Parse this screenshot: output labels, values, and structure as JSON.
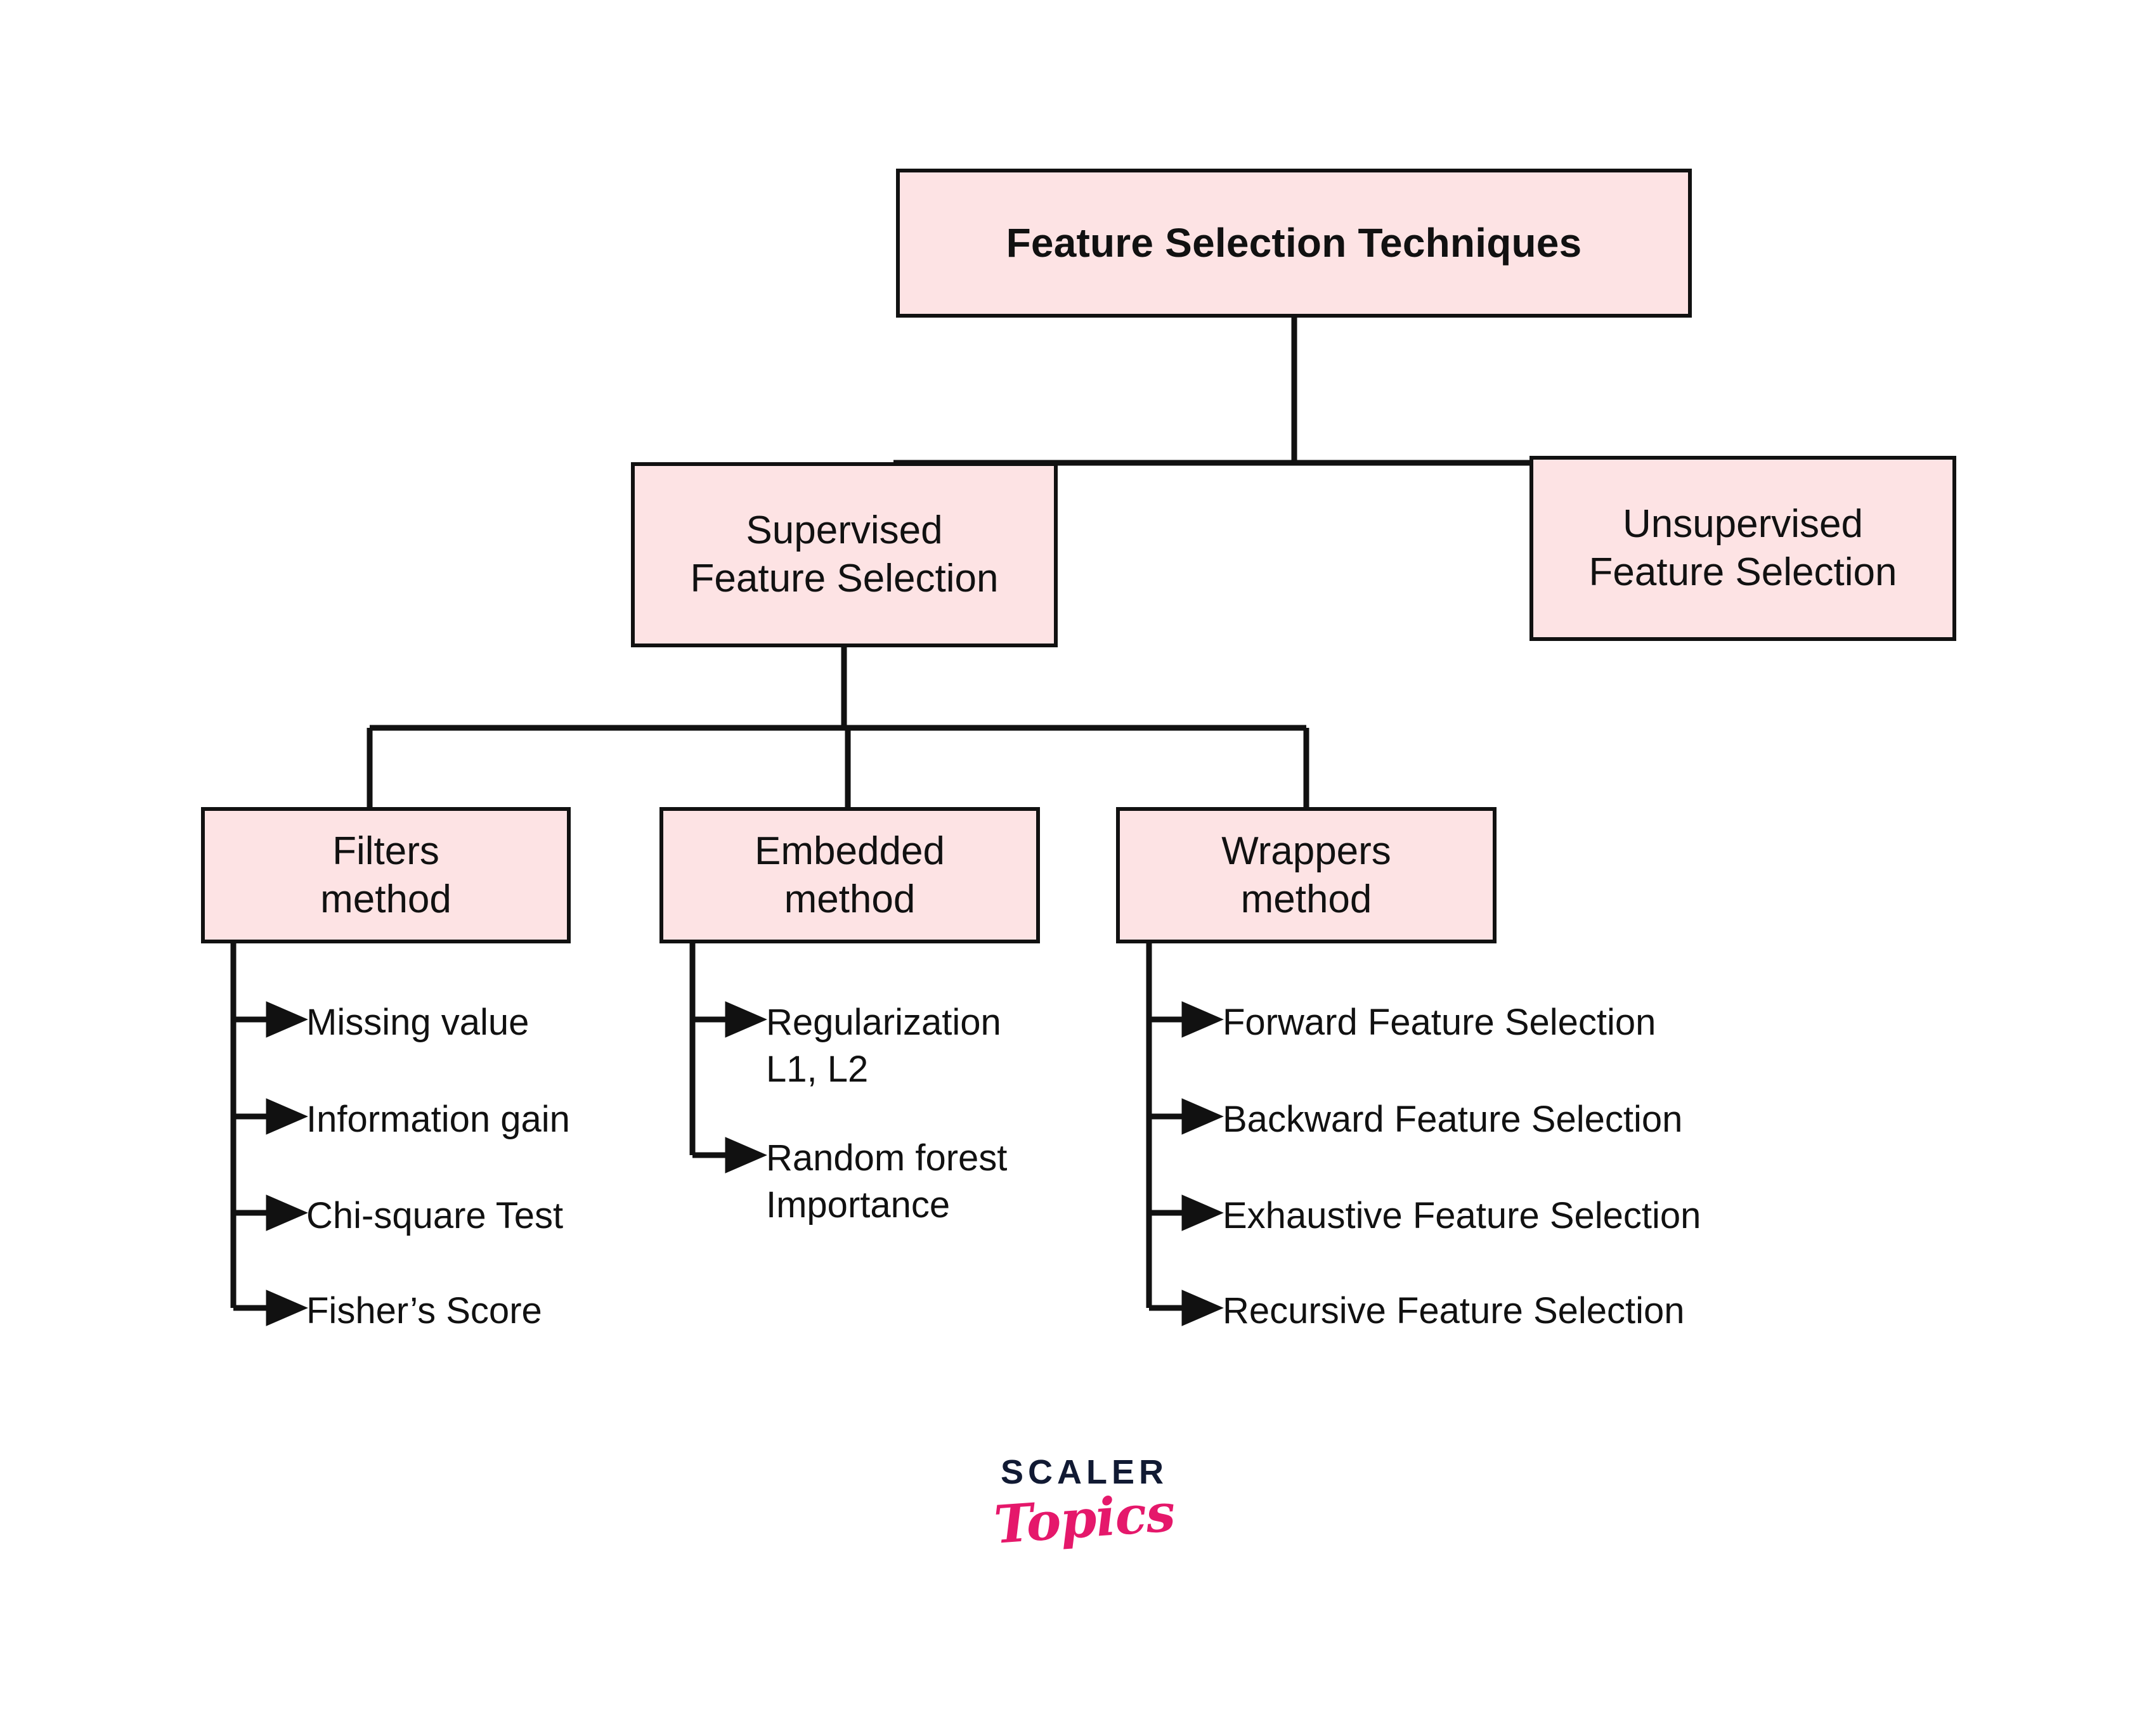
{
  "diagram": {
    "title": "Feature Selection Techniques",
    "type": "hierarchy-tree",
    "colors": {
      "node_fill": "#FDE3E4",
      "node_border": "#111111",
      "text": "#111111",
      "logo_dark": "#111A33",
      "logo_pink": "#E5186B",
      "background": "#FFFFFF"
    },
    "root": {
      "label": "Feature Selection Techniques"
    },
    "level2": [
      {
        "label": "Supervised\nFeature Selection"
      },
      {
        "label": "Unsupervised\nFeature Selection"
      }
    ],
    "level3": [
      {
        "label": "Filters\nmethod"
      },
      {
        "label": "Embedded\nmethod"
      },
      {
        "label": "Wrappers\nmethod"
      }
    ],
    "leaves": {
      "filters": [
        {
          "label": "Missing value"
        },
        {
          "label": "Information gain"
        },
        {
          "label": "Chi-square Test"
        },
        {
          "label": "Fisher’s Score"
        }
      ],
      "embedded": [
        {
          "label": "Regularization\nL1, L2"
        },
        {
          "label": "Random forest\nImportance"
        }
      ],
      "wrappers": [
        {
          "label": "Forward Feature Selection"
        },
        {
          "label": "Backward Feature Selection"
        },
        {
          "label": "Exhaustive Feature Selection"
        },
        {
          "label": "Recursive Feature Selection"
        }
      ]
    }
  },
  "logo": {
    "primary": "SCALER",
    "secondary": "Topics"
  }
}
